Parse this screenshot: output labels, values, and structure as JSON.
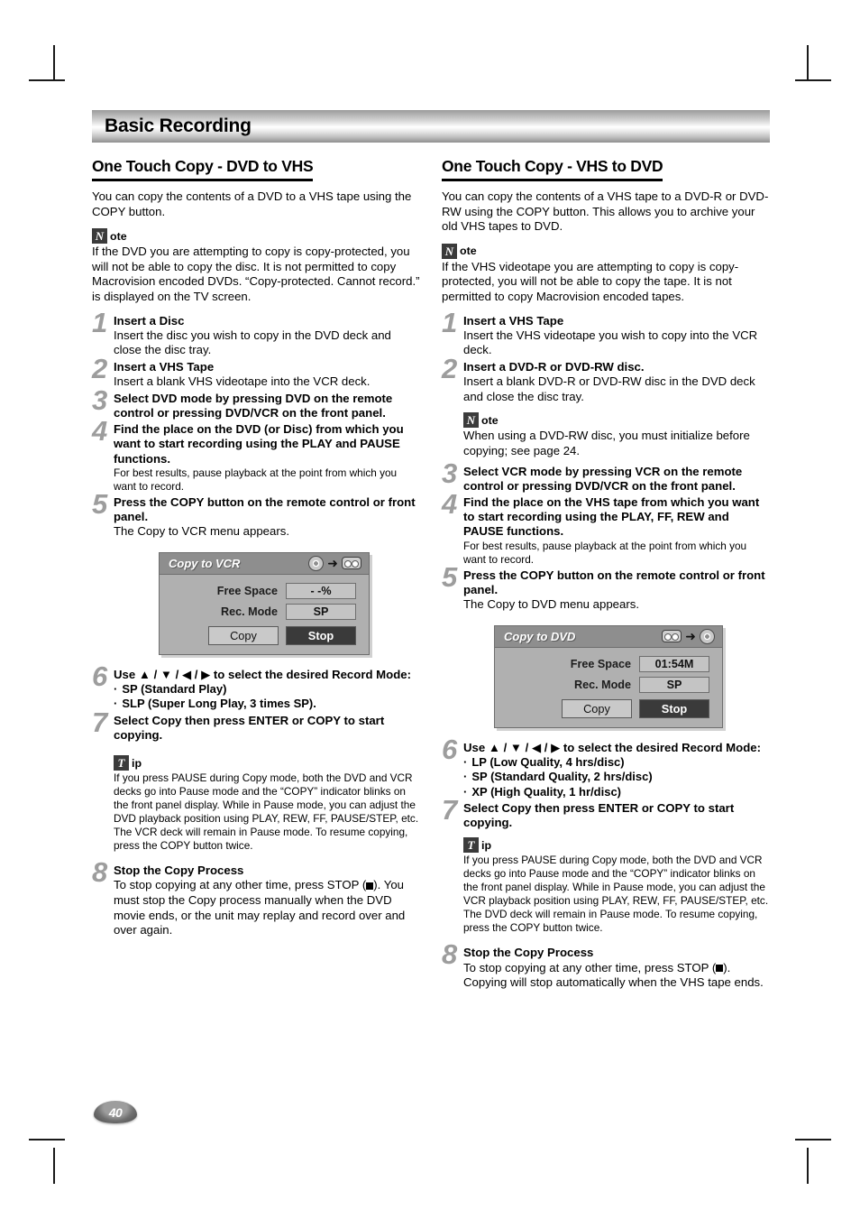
{
  "chapter": {
    "title": "Basic Recording"
  },
  "page": {
    "number": "40"
  },
  "icons": {
    "note_letter": "N",
    "note_word": "ote",
    "tip_letter": "T",
    "tip_word": "ip",
    "arrow": "➜"
  },
  "left": {
    "heading": "One Touch Copy - DVD to VHS",
    "intro": "You can copy the contents of a DVD to a VHS tape using the COPY button.",
    "note": "If the DVD you are attempting to copy is copy-protected, you will not be able to copy the disc. It is not permitted to copy Macrovision encoded DVDs. “Copy-protected. Cannot record.” is displayed on the TV screen.",
    "steps": [
      {
        "num": "1",
        "title": "Insert a Disc",
        "text": "Insert the disc you wish to copy in the DVD deck and close the disc tray."
      },
      {
        "num": "2",
        "title": "Insert a VHS Tape",
        "text": "Insert a blank VHS videotape into the VCR deck."
      },
      {
        "num": "3",
        "title": "Select DVD mode by pressing DVD on the remote control or pressing DVD/VCR on the front panel.",
        "text": ""
      },
      {
        "num": "4",
        "title": "Find the place on the DVD (or Disc) from which you want to start recording using the PLAY and PAUSE functions.",
        "small": "For best results, pause playback at the point from which you want to record."
      },
      {
        "num": "5",
        "title": "Press the COPY button on the remote control or front panel.",
        "text": "The Copy to VCR menu appears."
      },
      {
        "num": "6",
        "title": "Use ▲ / ▼ / ◀ / ▶ to select the desired Record Mode:",
        "bullets": [
          "SP (Standard Play)",
          "SLP (Super Long Play, 3 times SP)."
        ]
      },
      {
        "num": "7",
        "title": "Select Copy then press ENTER or COPY to start copying.",
        "text": ""
      },
      {
        "num": "8",
        "title": "Stop the Copy Process",
        "text_pre": "To stop copying at any other time, press STOP (",
        "text_post": "). You must stop the Copy process manually when the DVD movie ends, or the unit may replay and record over and over again."
      }
    ],
    "tip": "If you press PAUSE during Copy mode, both the DVD and VCR decks go into Pause mode and the “COPY” indicator blinks on the front panel display. While in Pause mode, you can adjust the DVD playback position using PLAY, REW, FF, PAUSE/STEP, etc. The VCR deck will remain in Pause mode. To resume copying, press the COPY button twice.",
    "dialog": {
      "title": "Copy to VCR",
      "source_icon": "disc-icon",
      "target_icon": "cassette-icon",
      "rows": [
        {
          "label": "Free Space",
          "value": "- -%"
        },
        {
          "label": "Rec. Mode",
          "value": "SP"
        }
      ],
      "buttons": [
        {
          "label": "Copy",
          "selected": false
        },
        {
          "label": "Stop",
          "selected": true
        }
      ]
    }
  },
  "right": {
    "heading": "One Touch Copy - VHS to DVD",
    "intro": "You can copy the contents of a VHS tape to a DVD-R or DVD-RW using the COPY button. This allows you to archive your old VHS tapes to DVD.",
    "note": "If the VHS videotape you are attempting to copy is copy-protected, you will not be able to copy the tape. It is not permitted to copy Macrovision encoded tapes.",
    "steps": [
      {
        "num": "1",
        "title": "Insert a VHS Tape",
        "text": "Insert the VHS videotape you wish to copy into the VCR deck."
      },
      {
        "num": "2",
        "title": "Insert a DVD-R or DVD-RW disc.",
        "text": "Insert a blank DVD-R or DVD-RW disc in the DVD deck and close the disc tray."
      },
      {
        "num": "3",
        "title": "Select VCR mode by pressing VCR on the remote control or pressing DVD/VCR on the front panel.",
        "text": ""
      },
      {
        "num": "4",
        "title": "Find the place on the VHS tape from which you want to start recording using the PLAY, FF, REW and PAUSE functions.",
        "small": "For best results, pause playback at the point from which you want to record."
      },
      {
        "num": "5",
        "title": "Press the COPY button on the remote control or front panel.",
        "text": "The Copy to DVD menu appears."
      },
      {
        "num": "6",
        "title": "Use ▲ / ▼ / ◀ / ▶ to select the desired Record Mode:",
        "bullets": [
          "LP (Low Quality, 4 hrs/disc)",
          "SP (Standard Quality, 2 hrs/disc)",
          "XP (High Quality, 1 hr/disc)"
        ]
      },
      {
        "num": "7",
        "title": "Select Copy then press ENTER or COPY to start copying.",
        "text": ""
      },
      {
        "num": "8",
        "title": "Stop the Copy Process",
        "text_pre": "To stop copying at any other time, press STOP (",
        "text_post": "). Copying will stop automatically when the VHS tape ends."
      }
    ],
    "step2_note": "When using a DVD-RW disc, you must initialize before copying; see page 24.",
    "tip": "If you press PAUSE during Copy mode, both the DVD and VCR decks go into Pause mode and the “COPY” indicator blinks on the front panel display. While in Pause mode, you can adjust the VCR playback position using PLAY, REW, FF, PAUSE/STEP, etc. The DVD deck will remain in Pause mode. To resume copying, press the COPY button twice.",
    "dialog": {
      "title": "Copy to DVD",
      "source_icon": "cassette-icon",
      "target_icon": "disc-icon",
      "rows": [
        {
          "label": "Free Space",
          "value": "01:54M"
        },
        {
          "label": "Rec. Mode",
          "value": "SP"
        }
      ],
      "buttons": [
        {
          "label": "Copy",
          "selected": false
        },
        {
          "label": "Stop",
          "selected": true
        }
      ]
    }
  }
}
